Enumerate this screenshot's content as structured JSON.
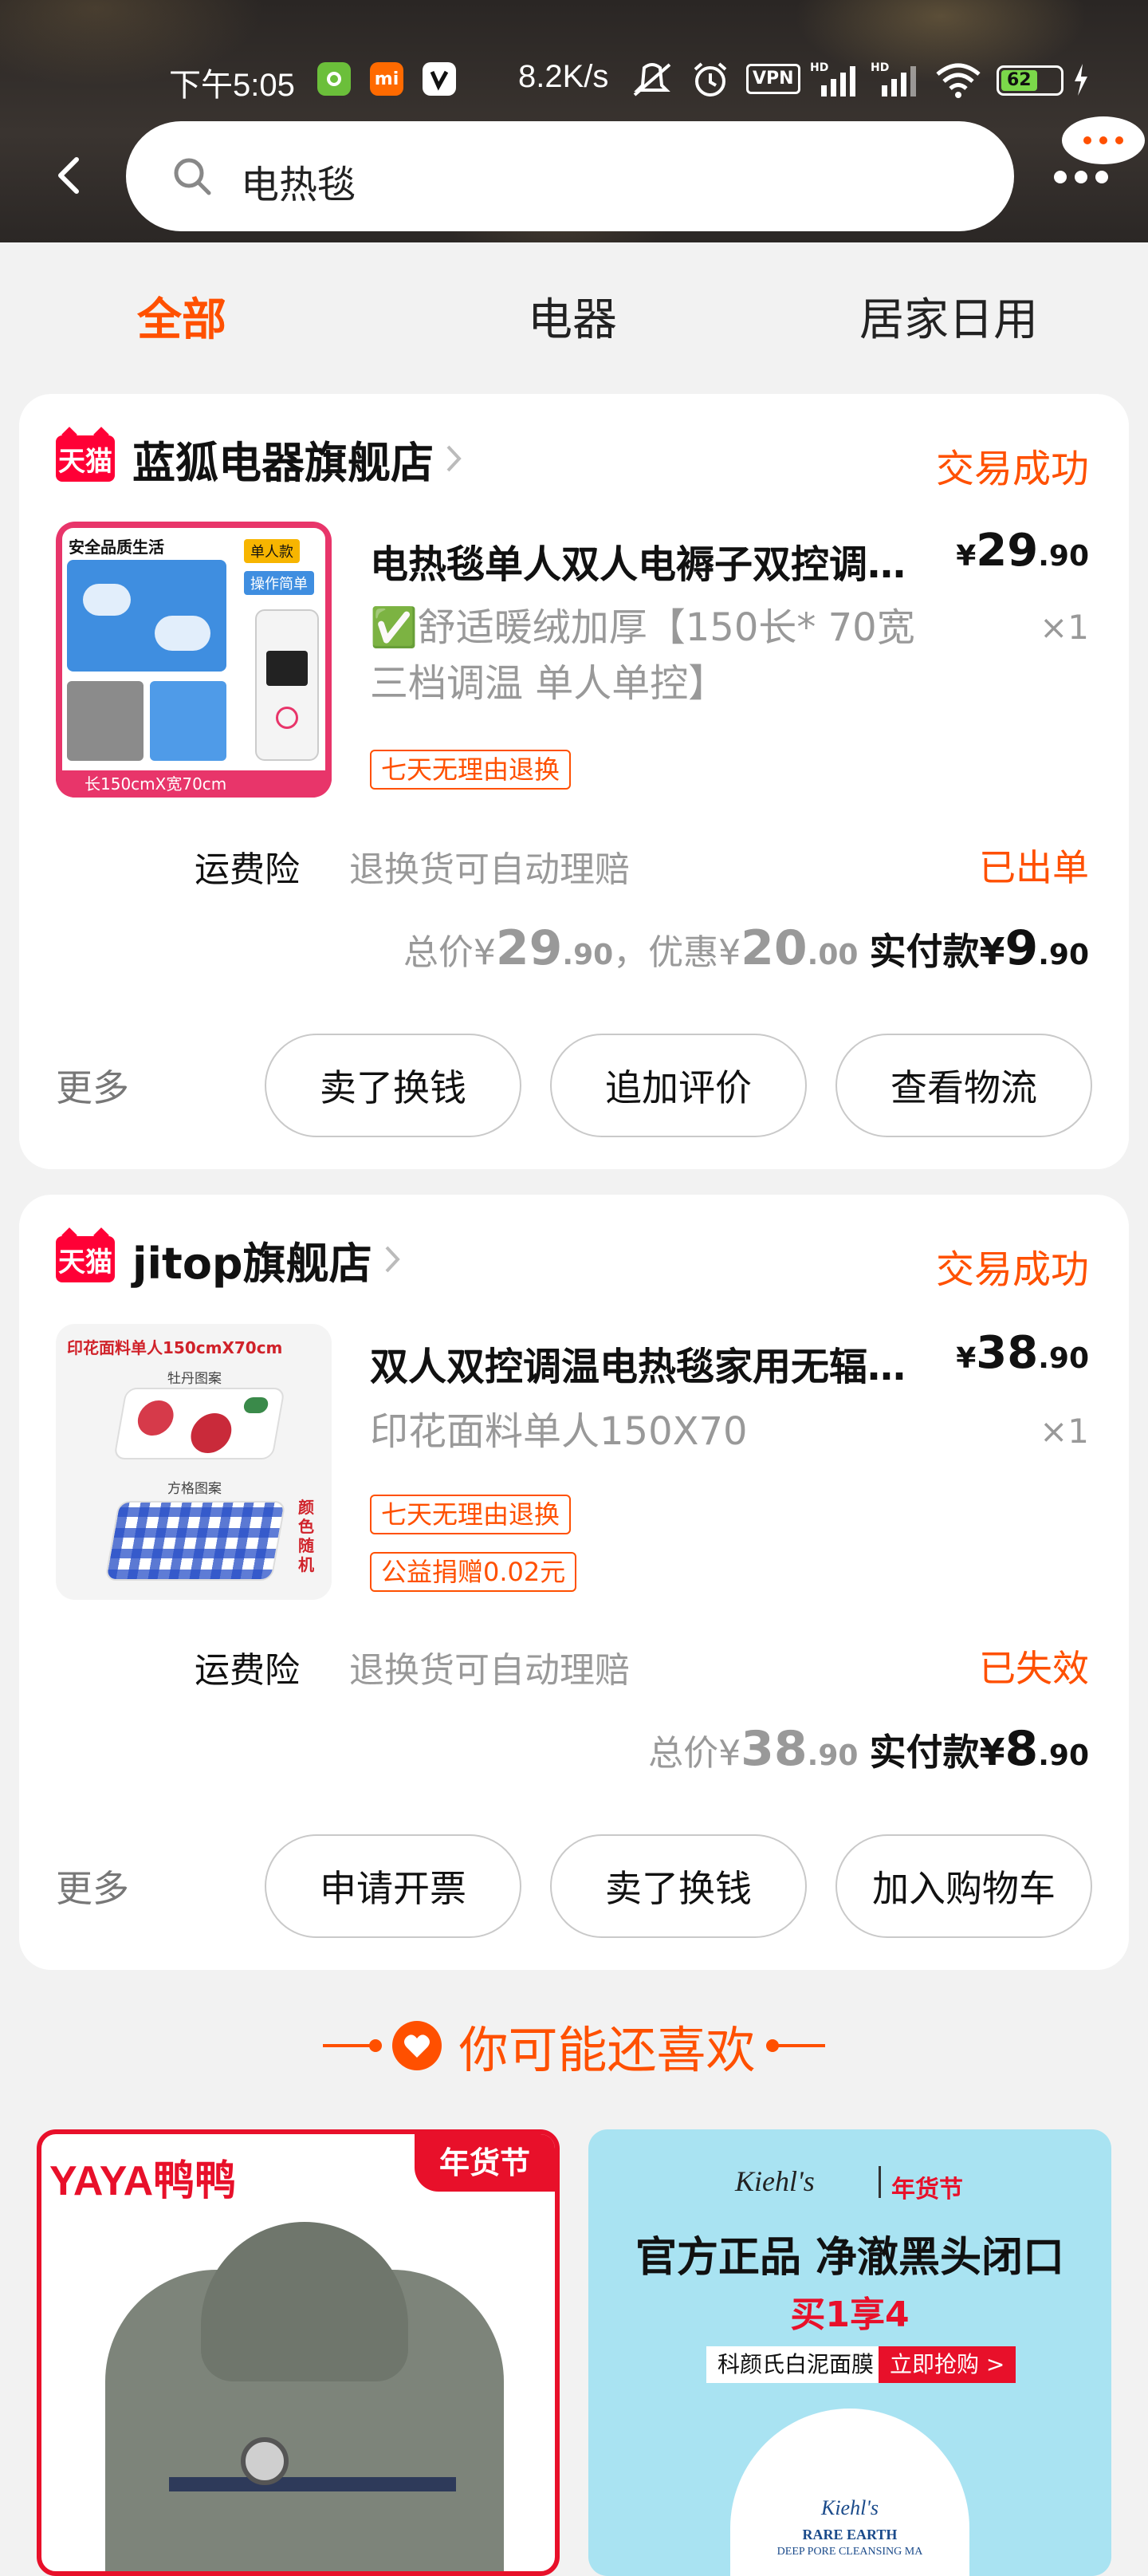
{
  "status_bar": {
    "time": "下午5:05",
    "speed": "8.2K/s",
    "vpn": "VPN",
    "battery": "62",
    "mi_badge": "mi"
  },
  "search": {
    "query": "电热毯"
  },
  "tabs": [
    {
      "label": "全部",
      "active": true
    },
    {
      "label": "电器",
      "active": false
    },
    {
      "label": "居家日用",
      "active": false
    }
  ],
  "orders": [
    {
      "platform": "天猫",
      "shop": "蓝狐电器旗舰店",
      "status": "交易成功",
      "title": "电热毯单人双人电褥子双控调温家用",
      "price_symbol": "¥",
      "price_int": "29",
      "price_dec": ".90",
      "spec": "✅舒适暖绒加厚【150长* 70宽 三档调温 单人单控】",
      "qty": "×1",
      "tags": [
        "七天无理由退换"
      ],
      "insurance_label": "运费险",
      "insurance_desc": "退换货可自动理赔",
      "insurance_status": "已出单",
      "total_label": "总价",
      "total_int": "29",
      "total_dec": ".90",
      "discount_label": "，优惠",
      "discount_int": "20",
      "discount_dec": ".00",
      "pay_label": "实付款",
      "pay_int": "9",
      "pay_dec": ".90",
      "more": "更多",
      "buttons": [
        "卖了换钱",
        "追加评价",
        "查看物流"
      ],
      "thumb_texts": {
        "headline": "安全品质生活",
        "tag1": "单人款",
        "tag2": "操作简单",
        "size": "长150cmX宽70cm"
      }
    },
    {
      "platform": "天猫",
      "shop": "jitop旗舰店",
      "status": "交易成功",
      "title": "双人双控调温电热毯家用无辐射安全",
      "price_symbol": "¥",
      "price_int": "38",
      "price_dec": ".90",
      "spec": "印花面料单人150X70",
      "qty": "×1",
      "tags": [
        "七天无理由退换",
        "公益捐赠0.02元"
      ],
      "insurance_label": "运费险",
      "insurance_desc": "退换货可自动理赔",
      "insurance_status": "已失效",
      "total_label": "总价",
      "total_int": "38",
      "total_dec": ".90",
      "pay_label": "实付款",
      "pay_int": "8",
      "pay_dec": ".90",
      "more": "更多",
      "buttons": [
        "申请开票",
        "卖了换钱",
        "加入购物车"
      ],
      "thumb_texts": {
        "headline": "印花面料单人150cmX70cm",
        "pattern1": "牡丹图案",
        "pattern2": "方格图案",
        "note": "颜色随机"
      }
    }
  ],
  "recommend": {
    "title": "你可能还喜欢",
    "products": [
      {
        "brand": "YAYA鸭鸭",
        "badge": "年货节"
      },
      {
        "brand": "Kiehl's",
        "badge": "年货节",
        "headline": "官方正品 净澈黑头闭口",
        "promo": "买1享4",
        "product": "科颜氏白泥面膜",
        "cta": "立即抢购 >",
        "jar_brand": "Kiehl's",
        "jar_text": "RARE EARTH",
        "jar_sub": "DEEP PORE CLEANSING MA"
      }
    ]
  },
  "colors": {
    "accent": "#ff5000",
    "tmall": "#ff0036",
    "kiehls_bg": "#a9e3f2"
  }
}
